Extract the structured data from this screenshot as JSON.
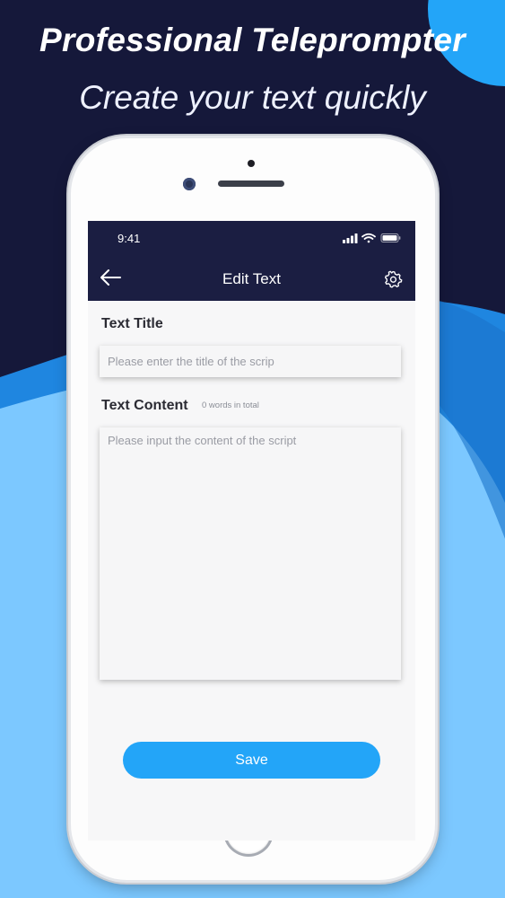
{
  "promo": {
    "headline": "Professional Teleprompter",
    "subheadline": "Create your text quickly"
  },
  "status_bar": {
    "time": "9:41"
  },
  "app_bar": {
    "title": "Edit Text"
  },
  "form": {
    "title_label": "Text Title",
    "title_placeholder": "Please enter the title of the scrip",
    "title_value": "",
    "content_label": "Text Content",
    "word_count": "0 words in total",
    "content_placeholder": "Please input the content of the script",
    "content_value": ""
  },
  "actions": {
    "save_label": "Save"
  },
  "colors": {
    "background_dark": "#15183a",
    "wave_mid": "#1f86e0",
    "wave_light": "#7cc8ff",
    "app_bar": "#1b1e42",
    "accent": "#23a5f8"
  },
  "icons": [
    "back-arrow-icon",
    "gear-icon",
    "signal-icon",
    "wifi-icon",
    "battery-icon"
  ]
}
